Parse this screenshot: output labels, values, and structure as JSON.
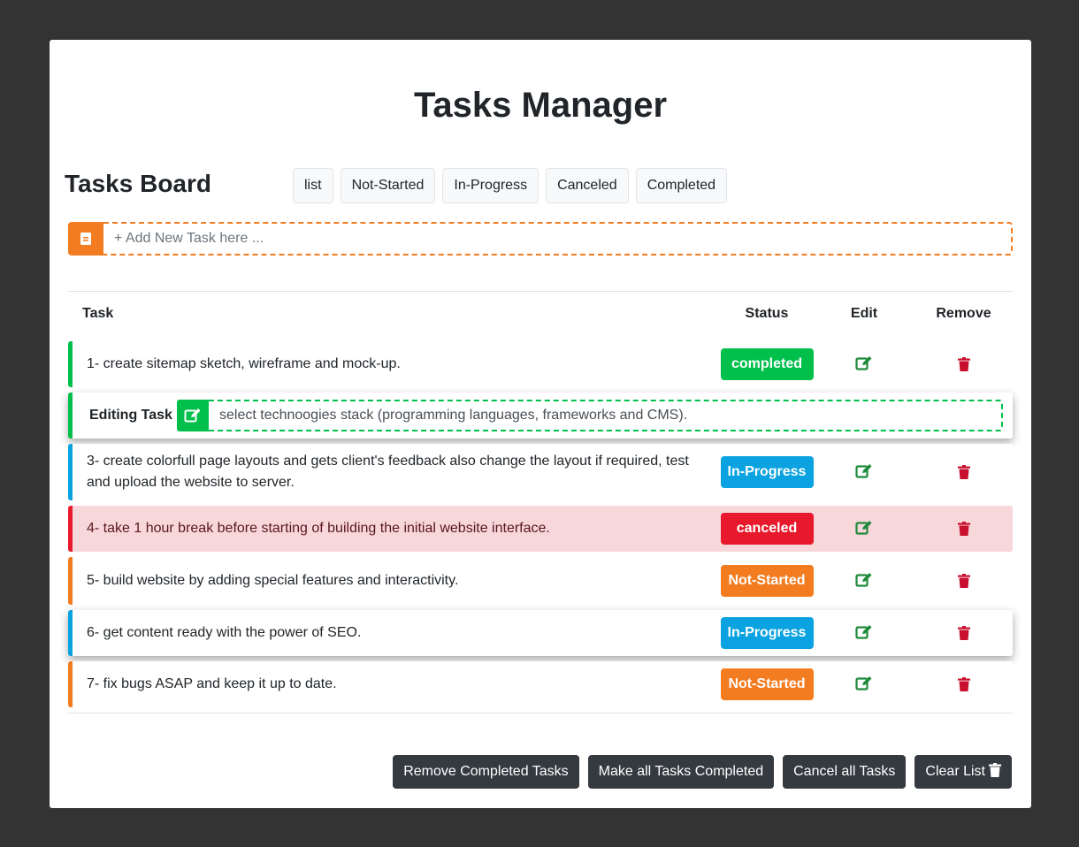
{
  "app_title": "Tasks Manager",
  "board_title": "Tasks Board",
  "filters": [
    "list",
    "Not-Started",
    "In-Progress",
    "Canceled",
    "Completed"
  ],
  "add_task": {
    "placeholder": "+ Add New Task here ...",
    "icon": "clipboard-icon",
    "accent": "#f47c20"
  },
  "table": {
    "headers": {
      "task": "Task",
      "status": "Status",
      "edit": "Edit",
      "remove": "Remove"
    }
  },
  "colors": {
    "completed": "#00c04b",
    "in_progress": "#0aa2e0",
    "canceled": "#e8192c",
    "not_started": "#f47c20",
    "edit_icon": "#1e8a3a",
    "remove_icon": "#c8102e"
  },
  "tasks": [
    {
      "text": "1- create sitemap sketch, wireframe and mock-up.",
      "status": "completed"
    },
    {
      "editing": true,
      "label": "Editing Task",
      "value": "select technoogies stack (programming languages, frameworks and CMS)."
    },
    {
      "text": "3- create colorfull page layouts and gets client's feedback also change the layout if required, test and upload the website to server.",
      "status": "In-Progress"
    },
    {
      "text": "4- take 1 hour break before starting of building the initial website interface.",
      "status": "canceled"
    },
    {
      "text": "5- build website by adding special features and interactivity.",
      "status": "Not-Started"
    },
    {
      "text": "6- get content ready with the power of SEO.",
      "status": "In-Progress"
    },
    {
      "text": "7- fix bugs ASAP and keep it up to date.",
      "status": "Not-Started"
    }
  ],
  "actions": [
    "Remove Completed Tasks",
    "Make all Tasks Completed",
    "Cancel all Tasks",
    "Clear List"
  ]
}
